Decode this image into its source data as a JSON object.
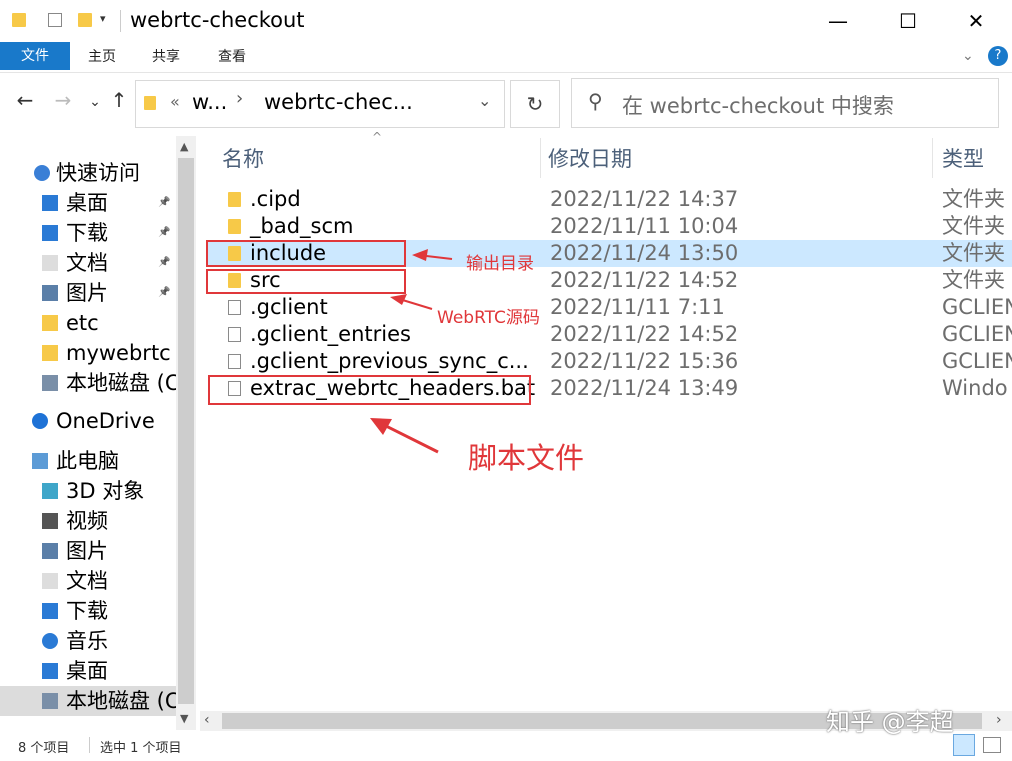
{
  "window": {
    "title": "webrtc-checkout",
    "minimize": "—",
    "maximize": "☐",
    "close": "✕"
  },
  "ribbon": {
    "tabs": [
      "文件",
      "主页",
      "共享",
      "查看"
    ],
    "help": "?"
  },
  "address": {
    "prefix": "«",
    "crumb1": "w...",
    "crumb2": "webrtc-chec...",
    "dropdown": "⌄",
    "refresh": "↻"
  },
  "search": {
    "placeholder": "在 webrtc-checkout 中搜索"
  },
  "sidebar": {
    "items": [
      {
        "label": "快速访问",
        "icon": "star-icon",
        "pinned": false
      },
      {
        "label": "桌面",
        "icon": "desktop-icon",
        "pinned": true
      },
      {
        "label": "下载",
        "icon": "download-icon",
        "pinned": true
      },
      {
        "label": "文档",
        "icon": "document-icon",
        "pinned": true
      },
      {
        "label": "图片",
        "icon": "pictures-icon",
        "pinned": true
      },
      {
        "label": "etc",
        "icon": "folder-icon",
        "pinned": false
      },
      {
        "label": "mywebrtc",
        "icon": "folder-icon",
        "pinned": false
      },
      {
        "label": "本地磁盘 (C",
        "icon": "drive-icon",
        "pinned": false
      },
      {
        "label": "OneDrive",
        "icon": "cloud-icon",
        "pinned": false
      },
      {
        "label": "此电脑",
        "icon": "computer-icon",
        "pinned": false
      },
      {
        "label": "3D 对象",
        "icon": "3d-objects-icon",
        "pinned": false
      },
      {
        "label": "视频",
        "icon": "video-icon",
        "pinned": false
      },
      {
        "label": "图片",
        "icon": "pictures-icon",
        "pinned": false
      },
      {
        "label": "文档",
        "icon": "document-icon",
        "pinned": false
      },
      {
        "label": "下载",
        "icon": "download-icon",
        "pinned": false
      },
      {
        "label": "音乐",
        "icon": "music-icon",
        "pinned": false
      },
      {
        "label": "桌面",
        "icon": "desktop-icon",
        "pinned": false
      },
      {
        "label": "本地磁盘 (C",
        "icon": "drive-icon",
        "pinned": false
      }
    ]
  },
  "columns": {
    "name": "名称",
    "date": "修改日期",
    "type": "类型"
  },
  "files": [
    {
      "name": ".cipd",
      "date": "2022/11/22 14:37",
      "type": "文件夹",
      "kind": "folder"
    },
    {
      "name": "_bad_scm",
      "date": "2022/11/11 10:04",
      "type": "文件夹",
      "kind": "folder"
    },
    {
      "name": "include",
      "date": "2022/11/24 13:50",
      "type": "文件夹",
      "kind": "folder",
      "selected": true
    },
    {
      "name": "src",
      "date": "2022/11/22 14:52",
      "type": "文件夹",
      "kind": "folder"
    },
    {
      "name": ".gclient",
      "date": "2022/11/11 7:11",
      "type": "GCLIEN",
      "kind": "file"
    },
    {
      "name": ".gclient_entries",
      "date": "2022/11/22 14:52",
      "type": "GCLIEN",
      "kind": "file"
    },
    {
      "name": ".gclient_previous_sync_c...",
      "date": "2022/11/22 15:36",
      "type": "GCLIEN",
      "kind": "file"
    },
    {
      "name": "extrac_webrtc_headers.bat",
      "date": "2022/11/24 13:49",
      "type": "Windo",
      "kind": "bat"
    }
  ],
  "annotations": {
    "output_dir": "输出目录",
    "webrtc_src": "WebRTC源码",
    "script_file": "脚本文件"
  },
  "status": {
    "count": "8 个项目",
    "selected": "选中 1 个项目"
  },
  "watermark": "知乎 @李超",
  "colors": {
    "accent": "#1979ca",
    "selection": "#cce8ff",
    "annotation_red": "#e0373a",
    "folder": "#f7c948"
  }
}
